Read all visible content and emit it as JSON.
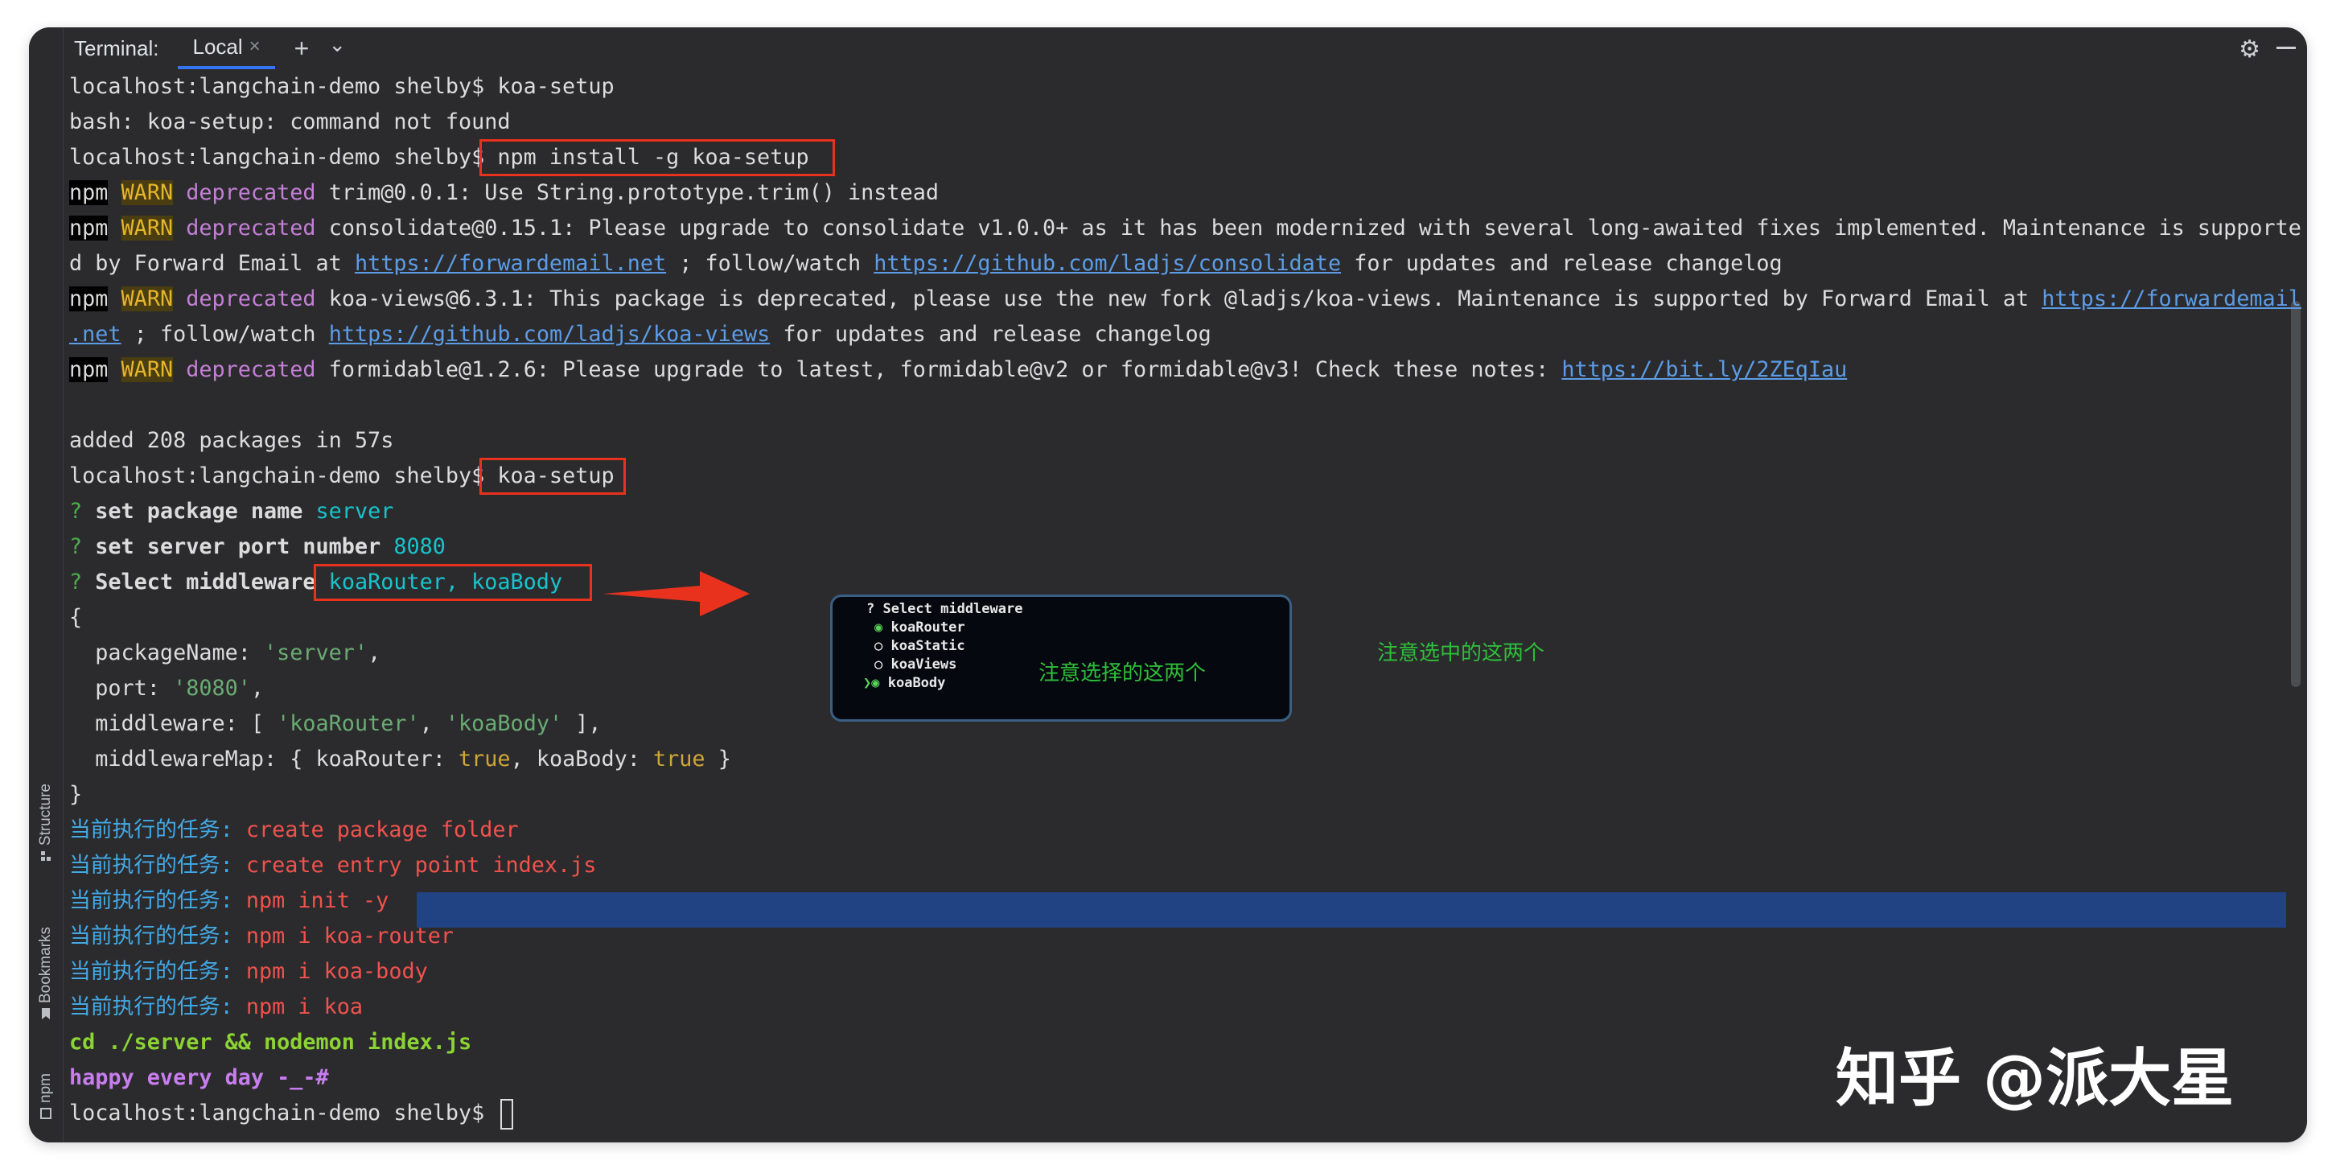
{
  "window": {
    "tab_bar": {
      "title": "Terminal:",
      "tab_label": "Local",
      "tab_close": "×",
      "add": "+",
      "dropdown": "⌄",
      "settings": "⚙"
    },
    "sidebar": {
      "structure": "Structure",
      "bookmarks": "Bookmarks",
      "npm": "npm"
    }
  },
  "terminal": {
    "l01": {
      "text": "localhost:langchain-demo shelby$ koa-setup"
    },
    "l02": {
      "text": "bash: koa-setup: command not found"
    },
    "l03": {
      "prompt": "localhost:langchain-demo shelby$",
      "cmd": " npm install -g koa-setup"
    },
    "l04": {
      "npm": "npm",
      "warn": "WARN",
      "dep": "deprecated",
      "msg": " trim@0.0.1: Use String.prototype.trim() instead"
    },
    "l05": {
      "npm": "npm",
      "warn": "WARN",
      "dep": "deprecated",
      "msg": " consolidate@0.15.1: Please upgrade to consolidate v1.0.0+ as it has been modernized with several long-awaited fixes implemented. Maintenance is supporte"
    },
    "l06": {
      "a": "d by Forward Email at ",
      "link1": "https://forwardemail.net",
      "b": " ; follow/watch ",
      "link2": "https://github.com/ladjs/consolidate",
      "c": " for updates and release changelog"
    },
    "l07": {
      "npm": "npm",
      "warn": "WARN",
      "dep": "deprecated",
      "msg": " koa-views@6.3.1: This package is deprecated, please use the new fork @ladjs/koa-views. Maintenance is supported by Forward Email at ",
      "link": "https://forwardemail"
    },
    "l08": {
      "link1": ".net",
      "a": " ; follow/watch ",
      "link2": "https://github.com/ladjs/koa-views",
      "b": " for updates and release changelog"
    },
    "l09": {
      "npm": "npm",
      "warn": "WARN",
      "dep": "deprecated",
      "msg": " formidable@1.2.6: Please upgrade to latest, formidable@v2 or formidable@v3! Check these notes: ",
      "link": "https://bit.ly/2ZEqIau"
    },
    "l11": {
      "text": "added 208 packages in 57s"
    },
    "l12": {
      "prompt": "localhost:langchain-demo shelby$",
      "cmd": " koa-setup"
    },
    "l13": {
      "q": "?",
      "label": " set package name",
      "val": " server"
    },
    "l14": {
      "q": "?",
      "label": " set server port number",
      "val": " 8080"
    },
    "l15": {
      "q": "?",
      "label": " Select middleware",
      "val": " koaRouter, koaBody"
    },
    "l16": {
      "text": "{"
    },
    "l17": {
      "key": "  packageName: ",
      "val": "'server'",
      "end": ","
    },
    "l18": {
      "key": "  port: ",
      "val": "'8080'",
      "end": ","
    },
    "l19": {
      "key": "  middleware: [ ",
      "v1": "'koaRouter'",
      "sep": ", ",
      "v2": "'koaBody'",
      "end": " ],"
    },
    "l20": {
      "key": "  middlewareMap: { koaRouter: ",
      "v1": "true",
      "sep": ", koaBody: ",
      "v2": "true",
      "end": " }"
    },
    "l21": {
      "text": "}"
    },
    "tasks": [
      {
        "label": "当前执行的任务:",
        "value": " create package folder"
      },
      {
        "label": "当前执行的任务:",
        "value": " create entry point index.js"
      },
      {
        "label": "当前执行的任务:",
        "value": " npm init -y"
      },
      {
        "label": "当前执行的任务:",
        "value": " npm i koa-router"
      },
      {
        "label": "当前执行的任务:",
        "value": " npm i koa-body"
      },
      {
        "label": "当前执行的任务:",
        "value": " npm i koa"
      }
    ],
    "l28": {
      "text": "cd ./server && nodemon index.js"
    },
    "l29": {
      "text": "happy every day -_-#"
    },
    "l30": {
      "prompt": "localhost:langchain-demo shelby$"
    }
  },
  "popup": {
    "title": "? Select middleware",
    "options": [
      {
        "mark": "◉",
        "label": "koaRouter"
      },
      {
        "mark": "○",
        "label": "koaStatic"
      },
      {
        "mark": "○",
        "label": "koaViews"
      },
      {
        "mark": "❯◉",
        "label": "koaBody"
      }
    ],
    "note": "注意选择的这两个"
  },
  "annotations": {
    "selected_note": "注意选中的这两个"
  },
  "watermark": "知乎 @派大星",
  "colors": {
    "highlight_box": "#e8321e",
    "selection": "#214283",
    "annotation": "#2fbe3a"
  }
}
